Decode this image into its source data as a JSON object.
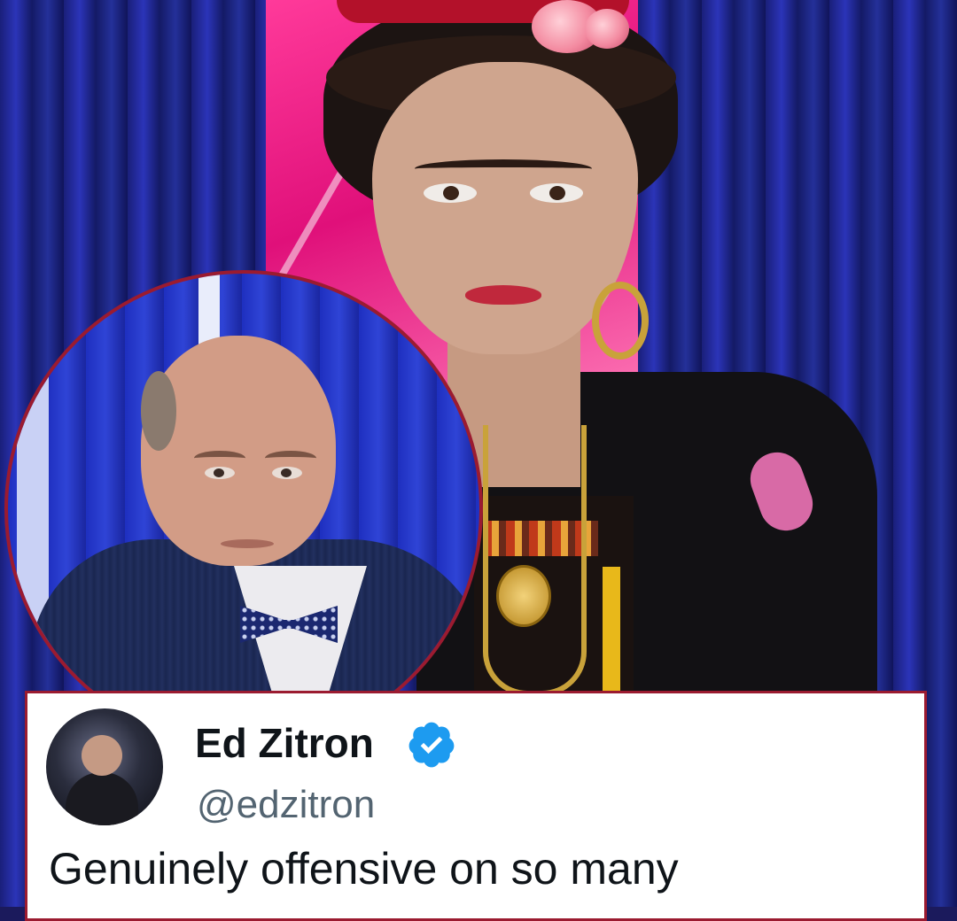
{
  "tweet": {
    "display_name": "Ed Zitron",
    "handle": "@edzitron",
    "verified": true,
    "text_visible": "Genuinely offensive on so many",
    "badge_icon": "verified-badge-icon",
    "badge_color": "#1d9bf0"
  },
  "colors": {
    "inset_border": "#9b1b30",
    "backdrop_pink": "#e0107a",
    "curtain_blue": "#1a1f7a"
  }
}
